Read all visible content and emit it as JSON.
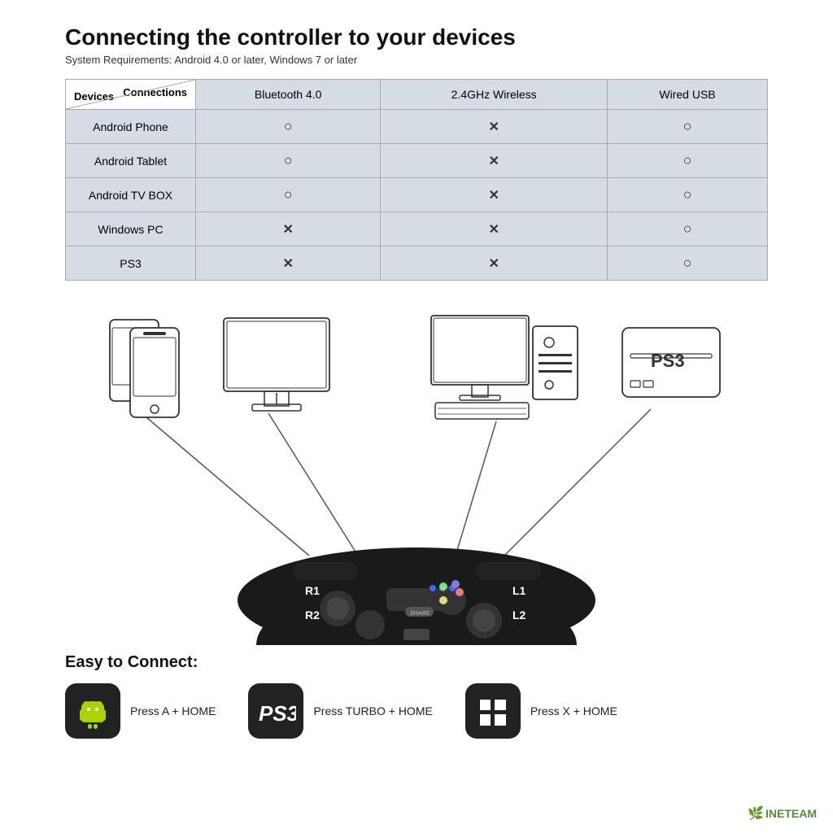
{
  "header": {
    "title": "Connecting the controller to your devices",
    "subtitle": "System Requirements: Android 4.0 or later, Windows 7 or later"
  },
  "table": {
    "corner": {
      "connections": "Connections",
      "devices": "Devices"
    },
    "columns": [
      "Bluetooth 4.0",
      "2.4GHz Wireless",
      "Wired USB"
    ],
    "rows": [
      {
        "device": "Android Phone",
        "bluetooth": "O",
        "wireless": "X",
        "wired": "O"
      },
      {
        "device": "Android Tablet",
        "bluetooth": "O",
        "wireless": "X",
        "wired": "O"
      },
      {
        "device": "Android TV BOX",
        "bluetooth": "O",
        "wireless": "X",
        "wired": "O"
      },
      {
        "device": "Windows PC",
        "bluetooth": "X",
        "wireless": "X",
        "wired": "O"
      },
      {
        "device": "PS3",
        "bluetooth": "X",
        "wireless": "X",
        "wired": "O"
      }
    ]
  },
  "easy_connect": {
    "title": "Easy to Connect:",
    "items": [
      {
        "platform": "Android",
        "instruction": "Press A + HOME"
      },
      {
        "platform": "PS3",
        "instruction": "Press TURBO + HOME"
      },
      {
        "platform": "Windows",
        "instruction": "Press X + HOME"
      }
    ]
  },
  "watermark": {
    "text": "INETEAM"
  }
}
